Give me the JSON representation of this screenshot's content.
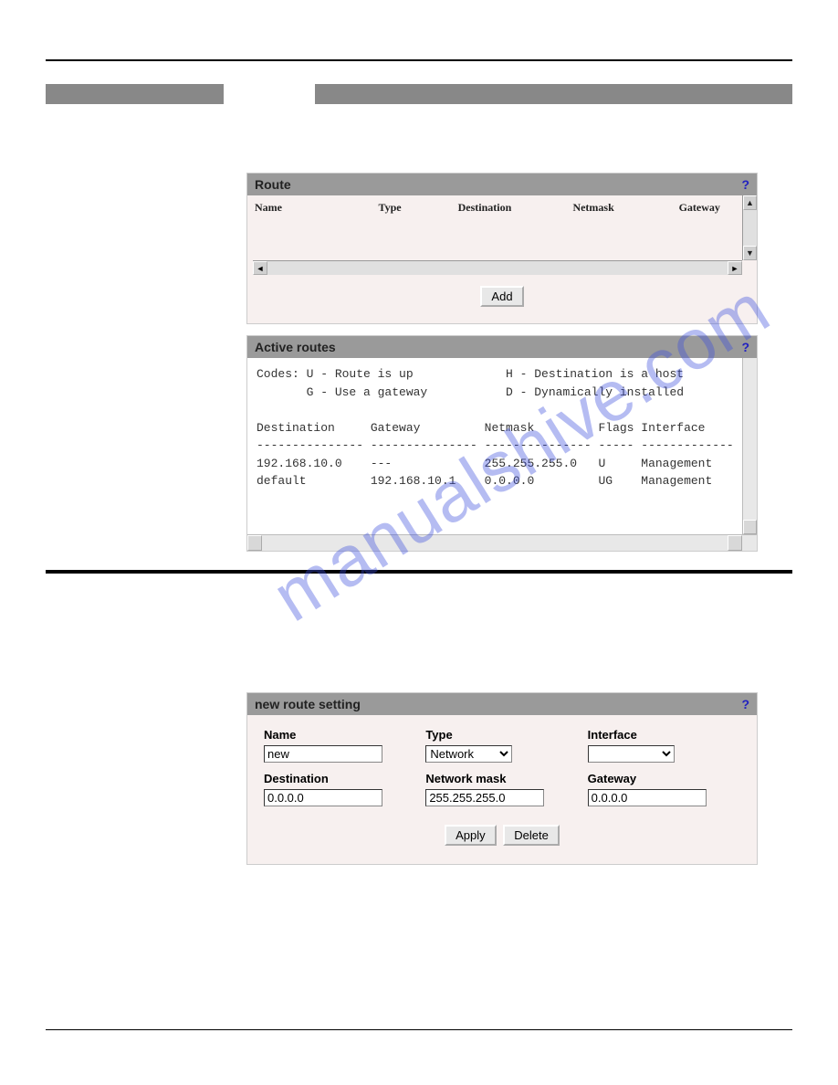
{
  "watermark": "manualshive.com",
  "panels": {
    "route": {
      "title": "Route",
      "help": "?",
      "columns": [
        "Name",
        "Type",
        "Destination",
        "Netmask",
        "Gateway"
      ],
      "addButton": "Add"
    },
    "activeRoutes": {
      "title": "Active routes",
      "help": "?",
      "codesLine1": "Codes: U - Route is up             H - Destination is a host",
      "codesLine2": "       G - Use a gateway           D - Dynamically installed",
      "tableHeader": "Destination     Gateway         Netmask         Flags Interface",
      "tableDivider": "--------------- --------------- --------------- ----- -------------",
      "rows": [
        "192.168.10.0    ---             255.255.255.0   U     Management",
        "default         192.168.10.1    0.0.0.0         UG    Management"
      ]
    },
    "newRoute": {
      "title": "new route setting",
      "help": "?",
      "labels": {
        "name": "Name",
        "type": "Type",
        "interface": "Interface",
        "destination": "Destination",
        "networkMask": "Network mask",
        "gateway": "Gateway"
      },
      "values": {
        "name": "new",
        "type": "Network",
        "interface": "",
        "destination": "0.0.0.0",
        "networkMask": "255.255.255.0",
        "gateway": "0.0.0.0"
      },
      "buttons": {
        "apply": "Apply",
        "delete": "Delete"
      }
    }
  }
}
